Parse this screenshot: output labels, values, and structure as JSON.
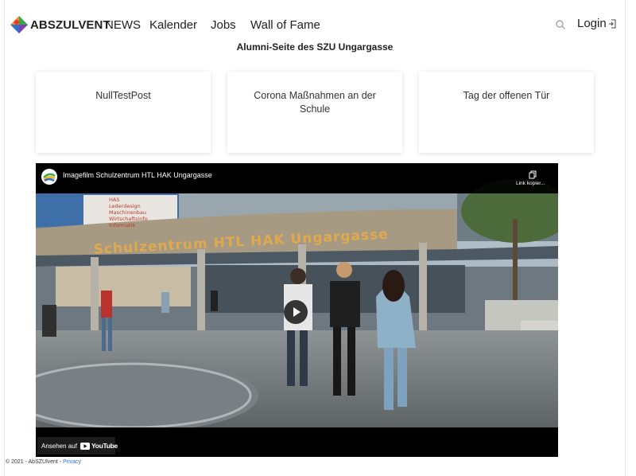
{
  "brand": {
    "name": "ABSZULVENT"
  },
  "nav": {
    "items": [
      {
        "label": "NEWS"
      },
      {
        "label": "Kalender"
      },
      {
        "label": "Jobs"
      },
      {
        "label": "Wall of Fame"
      }
    ],
    "login_label": "Login"
  },
  "page_title": "Alumni-Seite des SZU Ungargasse",
  "cards": [
    {
      "title": "NullTestPost"
    },
    {
      "title": "Corona Maßnahmen an der Schule"
    },
    {
      "title": "Tag der offenen Tür"
    }
  ],
  "video": {
    "title": "Imagefilm Schulzentrum HTL HAK Ungargasse",
    "copy_label": "Link kopier...",
    "watch_on_label": "Ansehen auf",
    "youtube_label": "YouTube",
    "building_sign": "Schulzentrum  HTL  HAK  Ungargasse",
    "poster_lines": [
      "HAS",
      "Lederdesign",
      "Maschinenbau",
      "Wirtschaftsinfo",
      "Informatik"
    ]
  },
  "footer": {
    "text": "© 2021 - AbSZUlvent - ",
    "privacy_label": "Privacy"
  },
  "colors": {
    "link": "#2a6fd6",
    "logo_green": "#3aa64a",
    "logo_orange": "#f28c28",
    "logo_blue": "#2f6fd0",
    "logo_red": "#e23a2e"
  }
}
